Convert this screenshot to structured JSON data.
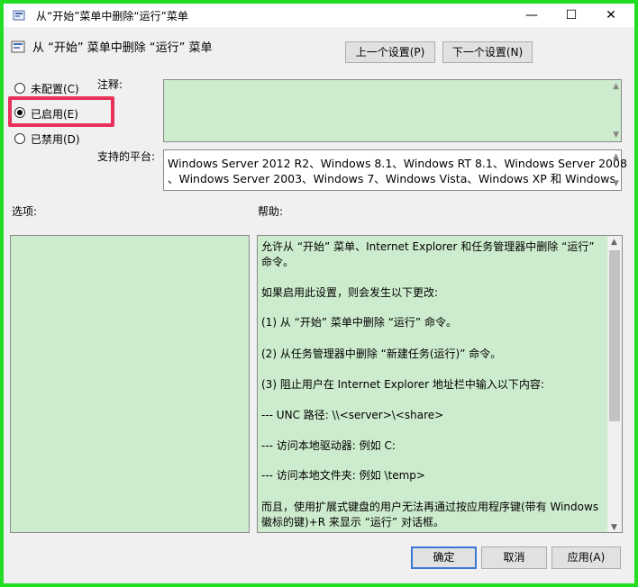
{
  "window": {
    "title": "从“开始”菜单中删除“运行”菜单",
    "minimize": "—",
    "maximize": "☐",
    "close": "✕"
  },
  "header": {
    "policy_name": "从 “开始” 菜单中删除 “运行” 菜单",
    "prev_button": "上一个设置(P)",
    "next_button": "下一个设置(N)"
  },
  "radios": {
    "not_configured": "未配置(C)",
    "enabled": "已启用(E)",
    "disabled": "已禁用(D)",
    "selected": "enabled"
  },
  "comment": {
    "label": "注释:",
    "value": ""
  },
  "platform": {
    "label": "支持的平台:",
    "lines": [
      "Windows Server 2012 R2、Windows 8.1、Windows RT 8.1、Windows Server 2008",
      "、Windows Server 2003、Windows 7、Windows Vista、Windows XP 和 Windows"
    ]
  },
  "options": {
    "label": "选项:"
  },
  "help": {
    "label": "帮助:",
    "lines": [
      "允许从 “开始” 菜单、Internet Explorer 和任务管理器中删除 “运行”",
      "命令。",
      "",
      "如果启用此设置，则会发生以下更改:",
      "",
      "(1) 从 “开始” 菜单中删除 “运行” 命令。",
      "",
      "(2) 从任务管理器中删除 “新建任务(运行)” 命令。",
      "",
      "(3) 阻止用户在 Internet Explorer 地址栏中输入以下内容:",
      "",
      "--- UNC 路径: \\\\<server>\\<share>",
      "",
      "--- 访问本地驱动器: 例如 C:",
      "",
      "--- 访问本地文件夹: 例如 \\temp>",
      "",
      "而且，使用扩展式键盘的用户无法再通过按应用程序键(带有 Windows",
      "徽标的键)+R 来显示 “运行” 对话框。"
    ]
  },
  "footer": {
    "ok": "确定",
    "cancel": "取消",
    "apply": "应用(A)"
  },
  "highlight_color": "#e8305a",
  "frame_color": "#22dd22",
  "field_color": "#cdeccd"
}
